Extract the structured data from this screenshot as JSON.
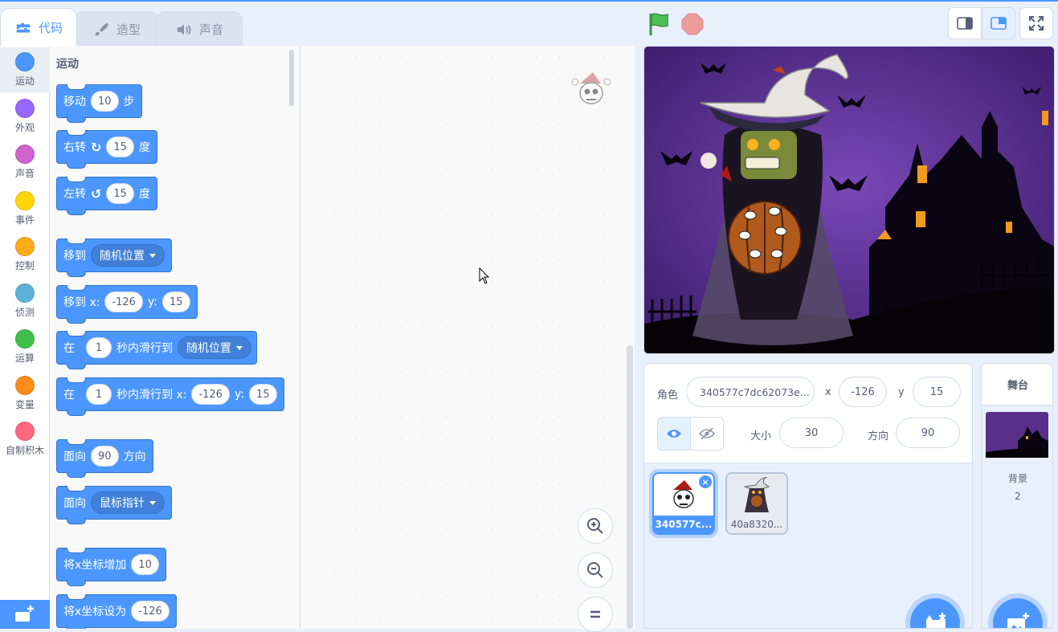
{
  "tabs": [
    {
      "label": "代码",
      "icon": "code-icon"
    },
    {
      "label": "造型",
      "icon": "brush-icon"
    },
    {
      "label": "声音",
      "icon": "speaker-icon"
    }
  ],
  "categories": [
    {
      "label": "运动",
      "color": "#4c97ff"
    },
    {
      "label": "外观",
      "color": "#9966ff"
    },
    {
      "label": "声音",
      "color": "#cf63cf"
    },
    {
      "label": "事件",
      "color": "#ffd500"
    },
    {
      "label": "控制",
      "color": "#ffab19"
    },
    {
      "label": "侦测",
      "color": "#5cb1d6"
    },
    {
      "label": "运算",
      "color": "#40bf4a"
    },
    {
      "label": "变量",
      "color": "#ff8c1a"
    },
    {
      "label": "自制积木",
      "color": "#ff6680"
    }
  ],
  "palette": {
    "section_title": "运动",
    "move": {
      "label": "移动",
      "steps": "10",
      "unit": "步"
    },
    "turn_right": {
      "label": "右转",
      "value": "15",
      "unit": "度"
    },
    "turn_left": {
      "label": "左转",
      "value": "15",
      "unit": "度"
    },
    "goto": {
      "label": "移到",
      "option": "随机位置"
    },
    "goto_xy": {
      "label": "移到 x:",
      "x": "-126",
      "ylabel": "y:",
      "y": "15"
    },
    "glide": {
      "label": "在",
      "secs": "1",
      "mid": "秒内滑行到",
      "option": "随机位置"
    },
    "glide_xy": {
      "label": "在",
      "secs": "1",
      "mid": "秒内滑行到 x:",
      "x": "-126",
      "ylabel": "y:",
      "y": "15"
    },
    "point_dir": {
      "label": "面向",
      "value": "90",
      "unit": "方向"
    },
    "point_towards": {
      "label": "面向",
      "option": "鼠标指针"
    },
    "change_x": {
      "label": "将x坐标增加",
      "value": "10"
    },
    "set_x": {
      "label": "将x坐标设为",
      "value": "-126"
    }
  },
  "sprite_info": {
    "sprite_label": "角色",
    "sprite_name": "340577c7dc62073e...",
    "x_label": "x",
    "x": "-126",
    "y_label": "y",
    "y": "15",
    "size_label": "大小",
    "size": "30",
    "direction_label": "方向",
    "direction": "90"
  },
  "sprites": [
    {
      "name": "340577c...",
      "selected": true
    },
    {
      "name": "40a8320..."
    }
  ],
  "stage_pane": {
    "title": "舞台",
    "backdrop_label": "背景",
    "backdrop_count": "2"
  },
  "colors": {
    "accent": "#4c97ff",
    "flag": "#4cbf56",
    "stop": "#ec9c9c"
  }
}
